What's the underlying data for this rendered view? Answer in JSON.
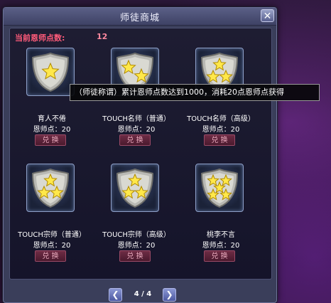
{
  "window": {
    "title": "师徒商城",
    "close_label": "✕",
    "points_label": "当前恩师点数:",
    "points_value": "12"
  },
  "items": [
    {
      "name": "育人不倦",
      "cost": "恩师点：20",
      "button": "兑 换",
      "stars": 1
    },
    {
      "name": "TOUCH名师（普通）",
      "cost": "恩师点：20",
      "button": "兑 换",
      "stars": 2
    },
    {
      "name": "TOUCH名师（高级）",
      "cost": "恩师点：20",
      "button": "兑 换",
      "stars": 3
    },
    {
      "name": "TOUCH宗师（普通）",
      "cost": "恩师点：20",
      "button": "兑 换",
      "stars": 3
    },
    {
      "name": "TOUCH宗师（高级）",
      "cost": "恩师点：20",
      "button": "兑 换",
      "stars": 3
    },
    {
      "name": "桃李不言",
      "cost": "恩师点：20",
      "button": "兑 换",
      "stars": 5
    }
  ],
  "pager": {
    "current": "4 / 4",
    "prev_icon": "chevron-left-icon",
    "next_icon": "chevron-right-icon"
  },
  "tooltip": {
    "text": "（师徒称谓）累计恩师点数达到1000，消耗20点恩师点获得"
  },
  "colors": {
    "accent": "#ff5b7a",
    "button_bg": "#6e2c45",
    "frame": "#3a3e5a"
  }
}
